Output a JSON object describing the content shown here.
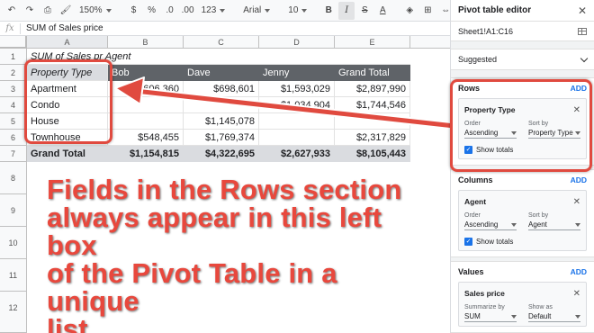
{
  "toolbar": {
    "zoom": "150%",
    "currency": "$",
    "percent": "%",
    "dec_less": ".0",
    "dec_more": ".00",
    "format_more": "123",
    "font": "Arial",
    "font_size": "10",
    "bold": "B",
    "italic": "I",
    "strike": "S",
    "text_color": "A"
  },
  "formula_bar": {
    "fx": "fx",
    "value": "SUM of Sales price"
  },
  "columns": [
    "A",
    "B",
    "C",
    "D",
    "E"
  ],
  "rows": [
    "1",
    "2",
    "3",
    "4",
    "5",
    "6",
    "7",
    "8",
    "9",
    "10",
    "11",
    "12"
  ],
  "pivot": {
    "title": "SUM of Sales pr Agent",
    "header": [
      "Property Type",
      "Bob",
      "Dave",
      "Jenny",
      "Grand Total"
    ],
    "data": [
      [
        "Apartment",
        "$606,360",
        "$698,601",
        "$1,593,029",
        "$2,897,990"
      ],
      [
        "Condo",
        "",
        "",
        "$1,034,904",
        "$1,744,546"
      ],
      [
        "House",
        "",
        "$1,145,078",
        "",
        ""
      ],
      [
        "Townhouse",
        "$548,455",
        "$1,769,374",
        "",
        "$2,317,829"
      ]
    ],
    "total": [
      "Grand Total",
      "$1,154,815",
      "$4,322,695",
      "$2,627,933",
      "$8,105,443"
    ]
  },
  "annotation": {
    "lines": [
      "Fields in the Rows section",
      "always appear in this left box",
      "of the Pivot Table in a unique",
      "list."
    ]
  },
  "panel": {
    "title": "Pivot table editor",
    "range": "Sheet1!A1:C16",
    "suggested": "Suggested",
    "rows": {
      "label": "Rows",
      "add": "ADD",
      "card": {
        "title": "Property Type",
        "order_label": "Order",
        "order_value": "Ascending",
        "sort_label": "Sort by",
        "sort_value": "Property Type",
        "show_totals": "Show totals"
      }
    },
    "columns": {
      "label": "Columns",
      "add": "ADD",
      "card": {
        "title": "Agent",
        "order_label": "Order",
        "order_value": "Ascending",
        "sort_label": "Sort by",
        "sort_value": "Agent",
        "show_totals": "Show totals"
      }
    },
    "values": {
      "label": "Values",
      "add": "ADD",
      "card": {
        "title": "Sales price",
        "summarize_label": "Summarize by",
        "summarize_value": "SUM",
        "show_label": "Show as",
        "show_value": "Default"
      }
    }
  },
  "colors": {
    "accent": "#1a73e8",
    "highlight": "#e04a3f",
    "header_bg": "#5f6368",
    "total_bg": "#dadce0"
  }
}
